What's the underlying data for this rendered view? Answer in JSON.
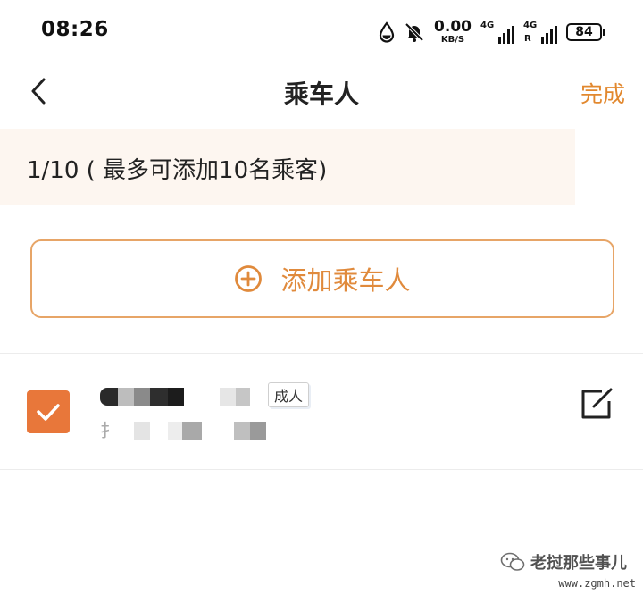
{
  "status_bar": {
    "time": "08:26",
    "net_speed_value": "0.00",
    "net_speed_unit": "KB/S",
    "signal1_type": "4G",
    "signal2_type": "4G",
    "signal2_roaming": "R",
    "battery": "84",
    "icons": [
      "water-drop-icon",
      "bell-muted-icon"
    ]
  },
  "nav": {
    "back_icon": "chevron-left-icon",
    "title": "乘车人",
    "done_label": "完成"
  },
  "notice": {
    "text": "1/10 ( 最多可添加10名乘客)"
  },
  "add_passenger": {
    "icon": "plus-circle-icon",
    "label": "添加乘车人"
  },
  "passengers": [
    {
      "selected": true,
      "type_badge": "成人",
      "name_id_partial": "扌",
      "edit_icon": "edit-icon"
    }
  ],
  "watermark": {
    "name": "老挝那些事儿",
    "url": "www.zgmh.net"
  },
  "colors": {
    "accent": "#E08A3C",
    "checkbox": "#E8773A",
    "notice_bg": "#FDF6F0",
    "border": "#E7A567"
  }
}
